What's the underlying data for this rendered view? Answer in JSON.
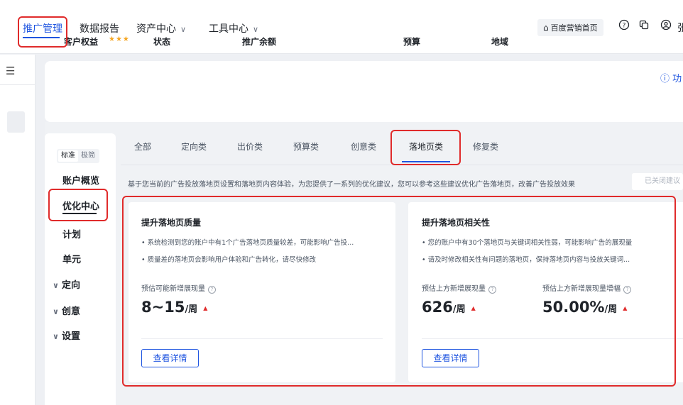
{
  "topnav": {
    "tabs": [
      {
        "label": "推广管理"
      },
      {
        "label": "数据报告"
      },
      {
        "label": "资产中心"
      },
      {
        "label": "工具中心"
      }
    ],
    "home_label": "百度营销首页",
    "cut_text": "张"
  },
  "stats": {
    "func_link": "功",
    "labels": [
      "客户权益",
      "状态",
      "推广余额",
      "预算",
      "地域"
    ],
    "stars": "★★★"
  },
  "sidenav": {
    "mode_standard": "标准",
    "mode_simple": "极简",
    "items": [
      {
        "label": "账户概览"
      },
      {
        "label": "优化中心"
      },
      {
        "label": "计划"
      },
      {
        "label": "单元"
      },
      {
        "label": "定向"
      },
      {
        "label": "创意"
      },
      {
        "label": "设置"
      }
    ]
  },
  "subtabs": [
    {
      "label": "全部"
    },
    {
      "label": "定向类"
    },
    {
      "label": "出价类"
    },
    {
      "label": "预算类"
    },
    {
      "label": "创意类"
    },
    {
      "label": "落地页类"
    },
    {
      "label": "修复类"
    }
  ],
  "description": "基于您当前的广告投放落地页设置和落地页内容体验，为您提供了一系列的优化建议，您可以参考这些建议优化广告落地页，改善广告投放效果",
  "closed_button": "已关闭建议",
  "cards": [
    {
      "title": "提升落地页质量",
      "bullets": [
        "系统检测到您的账户中有1个广告落地页质量较差，可能影响广告投...",
        "质量差的落地页会影响用户体验和广告转化，请尽快修改"
      ],
      "metrics": [
        {
          "label": "预估可能新增展现量",
          "value": "8~15",
          "unit": "/周"
        }
      ],
      "button": "查看详情"
    },
    {
      "title": "提升落地页相关性",
      "bullets": [
        "您的账户中有30个落地页与关键词相关性弱，可能影响广告的展现量",
        "请及时修改相关性有问题的落地页，保持落地页内容与投放关键词..."
      ],
      "metrics": [
        {
          "label": "预估上方新增展现量",
          "value": "626",
          "unit": "/周"
        },
        {
          "label": "预估上方新增展现量增幅",
          "value": "50.00%",
          "unit": "/周"
        }
      ],
      "button": "查看详情"
    }
  ],
  "colors": {
    "accent": "#1f55e0",
    "annotation": "#e02b2b",
    "up_arrow": "#e02b2b",
    "star": "#f5a623"
  }
}
